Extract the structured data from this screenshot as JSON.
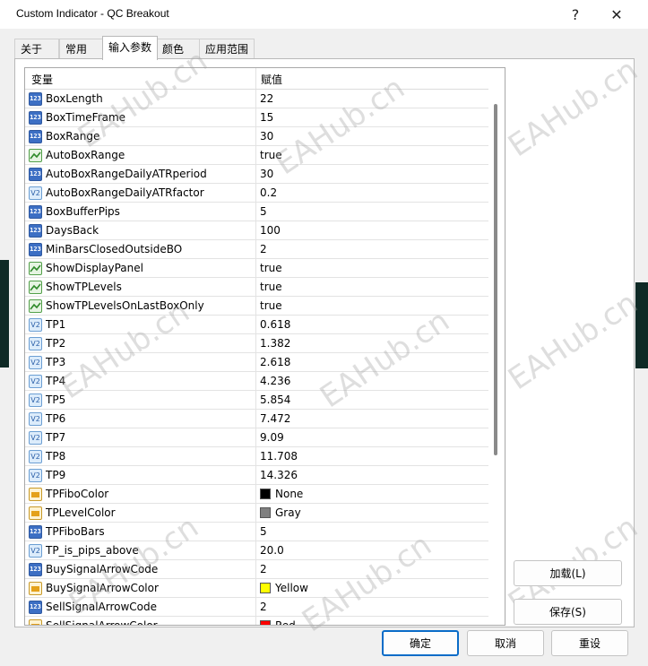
{
  "window": {
    "title": "Custom Indicator - QC Breakout",
    "help": "?",
    "close": "✕"
  },
  "tabs": [
    {
      "label": "关于"
    },
    {
      "label": "常用"
    },
    {
      "label": "输入参数",
      "active": true
    },
    {
      "label": "颜色"
    },
    {
      "label": "应用范围"
    }
  ],
  "table": {
    "col_variable": "变量",
    "col_value": "赋值",
    "rows": [
      {
        "type": "int",
        "name": "BoxLength",
        "value": "22"
      },
      {
        "type": "int",
        "name": "BoxTimeFrame",
        "value": "15"
      },
      {
        "type": "int",
        "name": "BoxRange",
        "value": "30"
      },
      {
        "type": "bool",
        "name": "AutoBoxRange",
        "value": "true"
      },
      {
        "type": "int",
        "name": "AutoBoxRangeDailyATRperiod",
        "value": "30"
      },
      {
        "type": "double",
        "name": "AutoBoxRangeDailyATRfactor",
        "value": "0.2"
      },
      {
        "type": "int",
        "name": "BoxBufferPips",
        "value": "5"
      },
      {
        "type": "int",
        "name": "DaysBack",
        "value": "100"
      },
      {
        "type": "int",
        "name": "MinBarsClosedOutsideBO",
        "value": "2"
      },
      {
        "type": "bool",
        "name": "ShowDisplayPanel",
        "value": "true"
      },
      {
        "type": "bool",
        "name": "ShowTPLevels",
        "value": "true"
      },
      {
        "type": "bool",
        "name": "ShowTPLevelsOnLastBoxOnly",
        "value": "true"
      },
      {
        "type": "double",
        "name": "TP1",
        "value": "0.618"
      },
      {
        "type": "double",
        "name": "TP2",
        "value": "1.382"
      },
      {
        "type": "double",
        "name": "TP3",
        "value": "2.618"
      },
      {
        "type": "double",
        "name": "TP4",
        "value": "4.236"
      },
      {
        "type": "double",
        "name": "TP5",
        "value": "5.854"
      },
      {
        "type": "double",
        "name": "TP6",
        "value": "7.472"
      },
      {
        "type": "double",
        "name": "TP7",
        "value": "9.09"
      },
      {
        "type": "double",
        "name": "TP8",
        "value": "11.708"
      },
      {
        "type": "double",
        "name": "TP9",
        "value": "14.326"
      },
      {
        "type": "color",
        "name": "TPFiboColor",
        "value": "None",
        "swatch": "#000000"
      },
      {
        "type": "color",
        "name": "TPLevelColor",
        "value": "Gray",
        "swatch": "#808080"
      },
      {
        "type": "int",
        "name": "TPFiboBars",
        "value": "5"
      },
      {
        "type": "double",
        "name": "TP_is_pips_above",
        "value": "20.0"
      },
      {
        "type": "int",
        "name": "BuySignalArrowCode",
        "value": "2"
      },
      {
        "type": "color",
        "name": "BuySignalArrowColor",
        "value": "Yellow",
        "swatch": "#ffff00"
      },
      {
        "type": "int",
        "name": "SellSignalArrowCode",
        "value": "2"
      },
      {
        "type": "color",
        "name": "SellSignalArrowColor",
        "value": "Red",
        "swatch": "#ff0000"
      }
    ]
  },
  "side_buttons": {
    "load": "加载(L)",
    "save": "保存(S)"
  },
  "footer_buttons": {
    "ok": "确定",
    "cancel": "取消",
    "reset": "重设"
  },
  "icon_labels": {
    "int": "123",
    "double": "V2"
  },
  "watermark": "EAHub.cn",
  "colors": {
    "primary_border": "#0a6cc8",
    "int_icon": "#3c6fc4",
    "bool_icon": "#53a04a",
    "color_icon": "#e4a11a"
  }
}
